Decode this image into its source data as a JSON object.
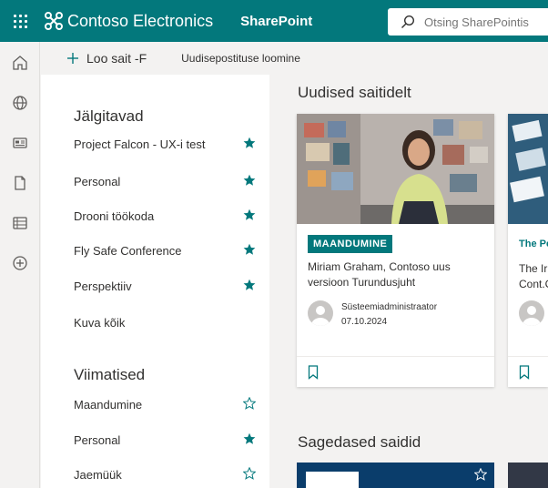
{
  "suitebar": {
    "brand": "Contoso Electronics",
    "app_name": "SharePoint",
    "search_placeholder": "Otsing SharePointis"
  },
  "appbar": {
    "items": [
      "home-icon",
      "globe-icon",
      "news-icon",
      "document-icon",
      "list-icon",
      "add-icon"
    ]
  },
  "commandbar": {
    "create_site": "Loo sait -F",
    "create_news": "Uudisepostituse loomine"
  },
  "following": {
    "title": "Jälgitavad",
    "sites": [
      {
        "name": "Project Falcon - UX-i test",
        "starred": true
      },
      {
        "name": "Personal",
        "starred": true
      },
      {
        "name": "Drooni töökoda",
        "starred": true
      },
      {
        "name": "Fly Safe Conference",
        "starred": true
      },
      {
        "name": "Perspektiiv",
        "starred": true
      }
    ],
    "see_all": "Kuva kõik"
  },
  "recent": {
    "title": "Viimatised",
    "sites": [
      {
        "name": "Maandumine",
        "starred": false
      },
      {
        "name": "Personal",
        "starred": true
      },
      {
        "name": "Jaemüük",
        "starred": false
      }
    ]
  },
  "news": {
    "title": "Uudised saitidelt",
    "cards": [
      {
        "site": "MAANDUMINE",
        "headline": "Miriam Graham, Contoso uus versioon Turundusjuht",
        "author": "Süsteemiadministraator",
        "date": "07.10.2024"
      },
      {
        "site": "The Pe",
        "headline": "The Ir",
        "headline2": "Cont.C"
      }
    ]
  },
  "frequent": {
    "title": "Sagedased saidid"
  },
  "colors": {
    "accent": "#03787c",
    "star": "#03787c",
    "text": "#323130"
  }
}
